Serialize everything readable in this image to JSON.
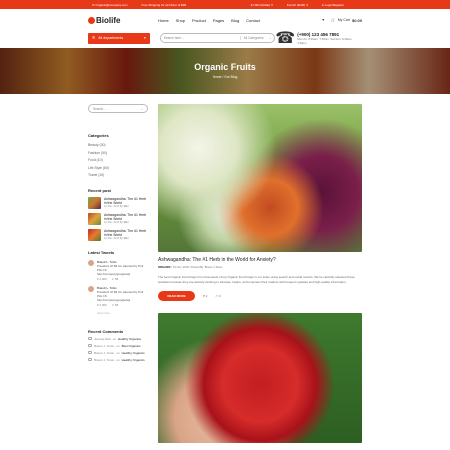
{
  "topbar": {
    "email": "Organic@company.com",
    "shipping": "Free Shipping for all Order of $99",
    "currency": "$ USD (Dollar)",
    "language": "French (EUR)",
    "login": "Login/Register"
  },
  "header": {
    "logo": "Biolife",
    "nav": [
      "Home",
      "Shop",
      "Product",
      "Pages",
      "Blog",
      "Contact"
    ],
    "cart_label": "My Cart",
    "cart_amount": "$0.00"
  },
  "searchbar": {
    "departments": "All departments",
    "placeholder": "Search here...",
    "category": "All Categories",
    "phone": "(+900) 123 456 7891",
    "phone_sub": "Mon-Fri: 8:30am- 7:30pm; Sat-Sun: 9:30am- 4:30pm"
  },
  "hero": {
    "title": "Organic Fruits",
    "breadcrumb": "Home  /  Our Blog"
  },
  "sidebar": {
    "search_placeholder": "Search...",
    "categories_title": "Categories",
    "categories": [
      "Beauty (30)",
      "Fashion (50)",
      "Food (10)",
      "Life Style (60)",
      "Travel (10)"
    ],
    "recent_title": "Recent post",
    "recent": [
      {
        "title": "Ashwagandha: The #1 Herb in the World",
        "date": "10 Mar, 2018 By",
        "author": "Max"
      },
      {
        "title": "Ashwagandha: The #1 Herb in the World",
        "date": "10 Mar, 2018 By",
        "author": "Max"
      },
      {
        "title": "Ashwagandha: The #1 Herb in the World",
        "date": "10 Mar, 2018 By",
        "author": "Max"
      }
    ],
    "tweets_title": "Latest Tweets",
    "tweets": [
      {
        "author": "Brandr L. Tohsi",
        "text": "President Of Bil Ion Haunted by Poll Pits CS",
        "link": "http://company/google/api",
        "likes": "2,900",
        "replies": "88"
      },
      {
        "author": "Brandr L. Tohsi",
        "text": "President Of Bil Ion Haunted by Poll Pits CS",
        "link": "http://company/google/api",
        "likes": "2,900",
        "replies": "88"
      }
    ],
    "more": "view more",
    "comments_title": "Recent Comments",
    "comments": [
      {
        "who": "Jessica Alba",
        "on": "on",
        "post": "Healthy Organics"
      },
      {
        "who": "Braum J. Teran",
        "on": "on",
        "post": "Best Organics"
      },
      {
        "who": "Braum J. Teran",
        "on": "on",
        "post": "Healthy Organics"
      },
      {
        "who": "Braum J. Teran",
        "on": "on",
        "post": "Healthy Organics"
      }
    ]
  },
  "post": {
    "title": "Ashwagandha: The #1 Herb in the World for Anxiety?",
    "tag": "ORGANIC",
    "meta": "/ 19 Nov, 2018 / Posted By: Braum J.Teran",
    "desc": "The best Organic Food blogs from thousands of top Organic Food blogs in our index using search and social metrics. We've carefully selected these websites because they are actively working to educate, inspire, and empower their readers with frequent updates and high-quality information.",
    "read_more": "READ MORE",
    "likes": "2",
    "comments": "0"
  },
  "colors": {
    "accent": "#e73918"
  }
}
